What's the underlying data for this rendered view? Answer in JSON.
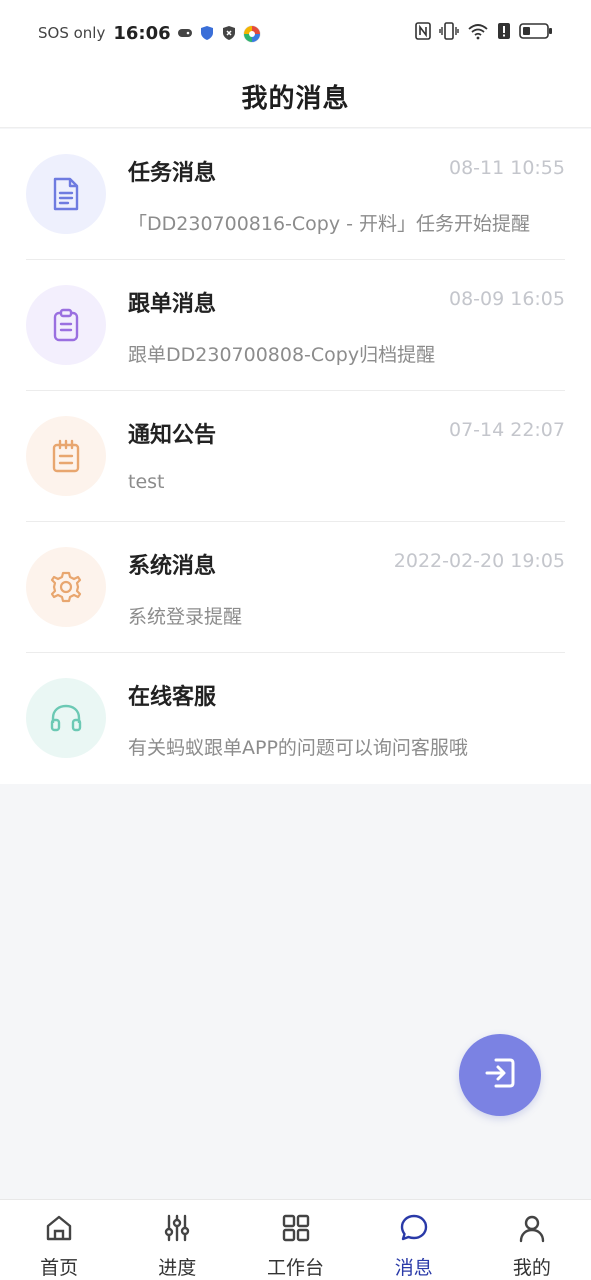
{
  "status_bar": {
    "carrier": "SOS only",
    "time": "16:06"
  },
  "header": {
    "title": "我的消息"
  },
  "messages": [
    {
      "title": "任务消息",
      "time": "08-11 10:55",
      "preview": "「DD230700816-Copy - 开料」任务开始提醒",
      "icon": "document-icon",
      "icon_color": "#6e7be0",
      "bg_color": "#eef0fd"
    },
    {
      "title": "跟单消息",
      "time": "08-09 16:05",
      "preview": "跟单DD230700808-Copy归档提醒",
      "icon": "clipboard-icon",
      "icon_color": "#9a6fe0",
      "bg_color": "#f3effd"
    },
    {
      "title": "通知公告",
      "time": "07-14 22:07",
      "preview": "test",
      "icon": "notepad-icon",
      "icon_color": "#e8a66f",
      "bg_color": "#fdf3ec"
    },
    {
      "title": "系统消息",
      "time": "2022-02-20 19:05",
      "preview": "系统登录提醒",
      "icon": "gear-icon",
      "icon_color": "#e8a66f",
      "bg_color": "#fdf3ec"
    },
    {
      "title": "在线客服",
      "time": "",
      "preview": "有关蚂蚁跟单APP的问题可以询问客服哦",
      "icon": "headset-icon",
      "icon_color": "#6cc9b4",
      "bg_color": "#eaf7f4"
    }
  ],
  "fab": {
    "icon": "exit-icon",
    "color": "#7b82e3"
  },
  "tab_bar": {
    "active_color": "#2a3aa8",
    "tabs": [
      {
        "label": "首页",
        "icon": "home-icon"
      },
      {
        "label": "进度",
        "icon": "sliders-icon"
      },
      {
        "label": "工作台",
        "icon": "grid-icon"
      },
      {
        "label": "消息",
        "icon": "chat-icon",
        "active": true
      },
      {
        "label": "我的",
        "icon": "user-icon"
      }
    ]
  }
}
